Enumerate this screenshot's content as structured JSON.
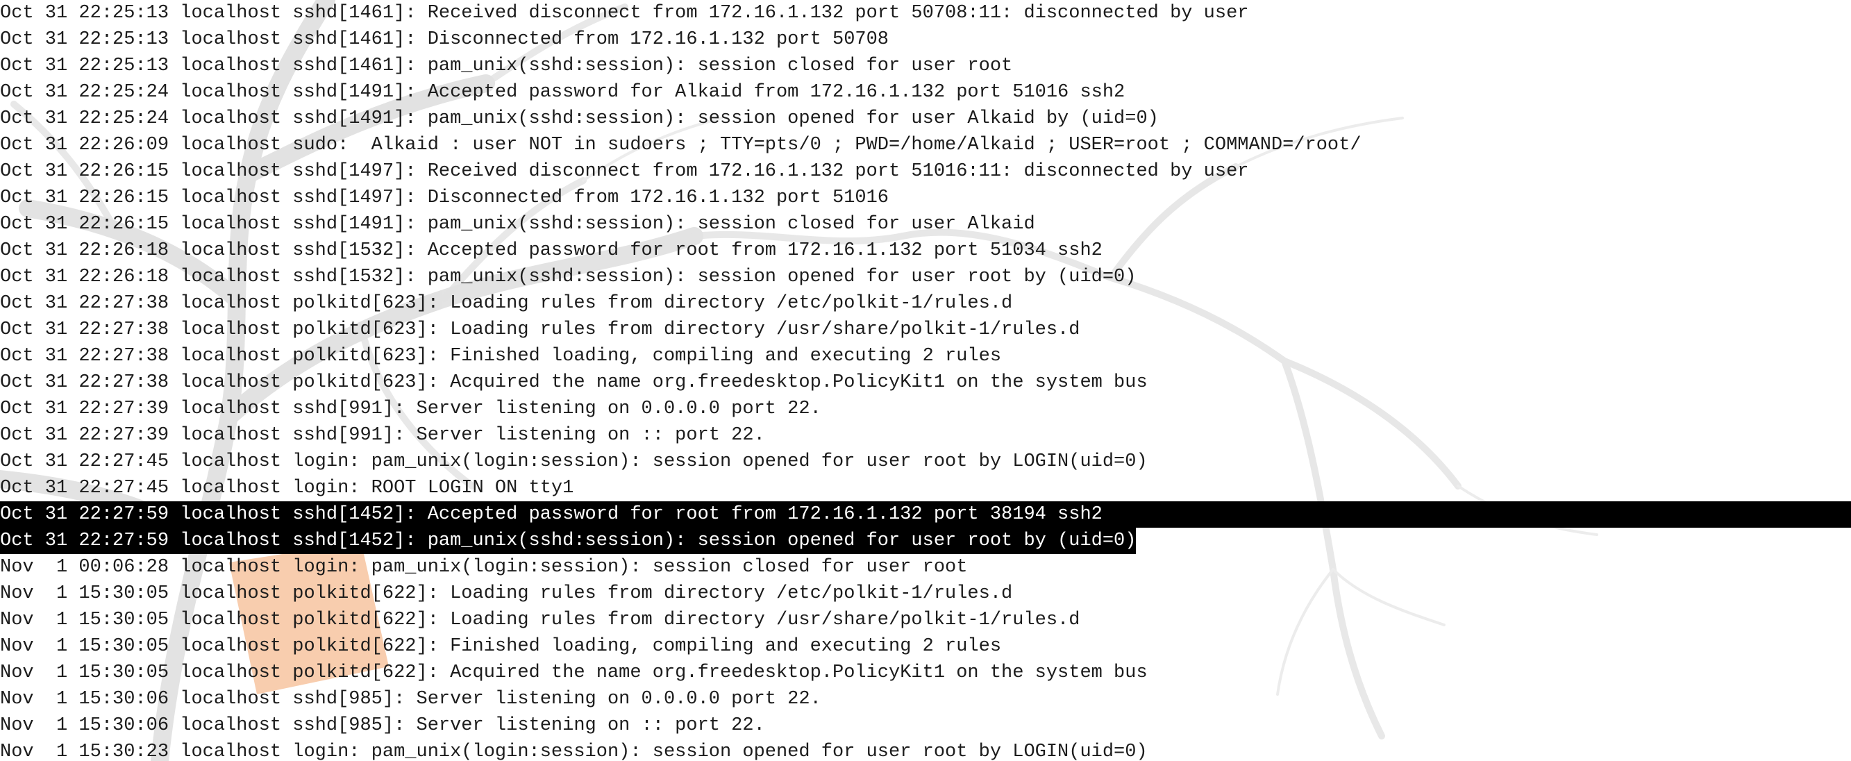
{
  "terminal": {
    "background": "#ffffff",
    "text_color": "#1c1c1c",
    "selection_color": "#000000",
    "lines": [
      {
        "text": "Oct 31 22:25:13 localhost sshd[1461]: Received disconnect from 172.16.1.132 port 50708:11: disconnected by user",
        "selected": false
      },
      {
        "text": "Oct 31 22:25:13 localhost sshd[1461]: Disconnected from 172.16.1.132 port 50708",
        "selected": false
      },
      {
        "text": "Oct 31 22:25:13 localhost sshd[1461]: pam_unix(sshd:session): session closed for user root",
        "selected": false
      },
      {
        "text": "Oct 31 22:25:24 localhost sshd[1491]: Accepted password for Alkaid from 172.16.1.132 port 51016 ssh2",
        "selected": false
      },
      {
        "text": "Oct 31 22:25:24 localhost sshd[1491]: pam_unix(sshd:session): session opened for user Alkaid by (uid=0)",
        "selected": false
      },
      {
        "text": "Oct 31 22:26:09 localhost sudo:  Alkaid : user NOT in sudoers ; TTY=pts/0 ; PWD=/home/Alkaid ; USER=root ; COMMAND=/root/",
        "selected": false
      },
      {
        "text": "Oct 31 22:26:15 localhost sshd[1497]: Received disconnect from 172.16.1.132 port 51016:11: disconnected by user",
        "selected": false
      },
      {
        "text": "Oct 31 22:26:15 localhost sshd[1497]: Disconnected from 172.16.1.132 port 51016",
        "selected": false
      },
      {
        "text": "Oct 31 22:26:15 localhost sshd[1491]: pam_unix(sshd:session): session closed for user Alkaid",
        "selected": false
      },
      {
        "text": "Oct 31 22:26:18 localhost sshd[1532]: Accepted password for root from 172.16.1.132 port 51034 ssh2",
        "selected": false
      },
      {
        "text": "Oct 31 22:26:18 localhost sshd[1532]: pam_unix(sshd:session): session opened for user root by (uid=0)",
        "selected": false
      },
      {
        "text": "Oct 31 22:27:38 localhost polkitd[623]: Loading rules from directory /etc/polkit-1/rules.d",
        "selected": false
      },
      {
        "text": "Oct 31 22:27:38 localhost polkitd[623]: Loading rules from directory /usr/share/polkit-1/rules.d",
        "selected": false
      },
      {
        "text": "Oct 31 22:27:38 localhost polkitd[623]: Finished loading, compiling and executing 2 rules",
        "selected": false
      },
      {
        "text": "Oct 31 22:27:38 localhost polkitd[623]: Acquired the name org.freedesktop.PolicyKit1 on the system bus",
        "selected": false
      },
      {
        "text": "Oct 31 22:27:39 localhost sshd[991]: Server listening on 0.0.0.0 port 22.",
        "selected": false
      },
      {
        "text": "Oct 31 22:27:39 localhost sshd[991]: Server listening on :: port 22.",
        "selected": false
      },
      {
        "text": "Oct 31 22:27:45 localhost login: pam_unix(login:session): session opened for user root by LOGIN(uid=0)",
        "selected": false
      },
      {
        "text": "Oct 31 22:27:45 localhost login: ROOT LOGIN ON tty1",
        "selected": false
      },
      {
        "text": "Oct 31 22:27:59 localhost sshd[1452]: Accepted password for root from 172.16.1.132 port 38194 ssh2",
        "selected": "full"
      },
      {
        "text": "Oct 31 22:27:59 localhost sshd[1452]: pam_unix(sshd:session): session opened for user root by (uid=0)",
        "selected": "partial"
      },
      {
        "text": "Nov  1 00:06:28 localhost login: pam_unix(login:session): session closed for user root",
        "selected": false
      },
      {
        "text": "Nov  1 15:30:05 localhost polkitd[622]: Loading rules from directory /etc/polkit-1/rules.d",
        "selected": false
      },
      {
        "text": "Nov  1 15:30:05 localhost polkitd[622]: Loading rules from directory /usr/share/polkit-1/rules.d",
        "selected": false
      },
      {
        "text": "Nov  1 15:30:05 localhost polkitd[622]: Finished loading, compiling and executing 2 rules",
        "selected": false
      },
      {
        "text": "Nov  1 15:30:05 localhost polkitd[622]: Acquired the name org.freedesktop.PolicyKit1 on the system bus",
        "selected": false
      },
      {
        "text": "Nov  1 15:30:06 localhost sshd[985]: Server listening on 0.0.0.0 port 22.",
        "selected": false
      },
      {
        "text": "Nov  1 15:30:06 localhost sshd[985]: Server listening on :: port 22.",
        "selected": false
      },
      {
        "text": "Nov  1 15:30:23 localhost login: pam_unix(login:session): session opened for user root by LOGIN(uid=0)",
        "selected": false
      }
    ]
  }
}
